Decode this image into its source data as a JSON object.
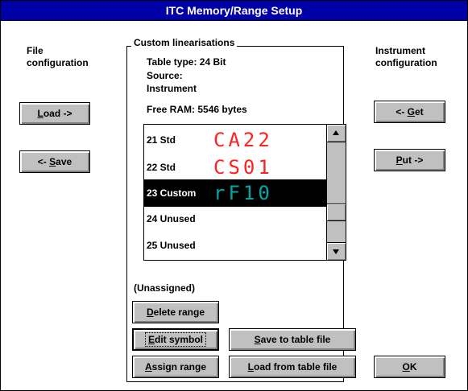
{
  "window": {
    "title": "ITC Memory/Range Setup"
  },
  "file_config": {
    "heading_line1": "File",
    "heading_line2": "configuration",
    "load_label": "Load ->",
    "save_label": "<- Save"
  },
  "instrument_config": {
    "heading_line1": "Instrument",
    "heading_line2": "configuration",
    "get_label": "<- Get",
    "put_label": "Put ->"
  },
  "custom": {
    "group_title": "Custom linearisations",
    "table_type": "Table type:  24 Bit",
    "source_label": "Source:",
    "source_value": "Instrument",
    "free_ram": "Free RAM: 5546 bytes",
    "items": [
      {
        "label": "21 Std",
        "symbol": "CA22",
        "symbol_color": "#ff2020"
      },
      {
        "label": "22 Std",
        "symbol": "CS01",
        "symbol_color": "#ff2020"
      },
      {
        "label": "23 Custom",
        "symbol": "rF10",
        "symbol_color": "#00a8a8"
      },
      {
        "label": "24 Unused",
        "symbol": ""
      },
      {
        "label": "25 Unused",
        "symbol": ""
      }
    ],
    "selected_index": 2,
    "assignment_status": "(Unassigned)",
    "delete_range": "Delete range",
    "edit_symbol": "Edit symbol",
    "assign_range": "Assign range",
    "save_to_table_file": "Save to table file",
    "load_from_table_file": "Load from table file"
  },
  "ok_label": "OK",
  "colors": {
    "titlebar": "#0000a8",
    "button_face": "#c0c0c0",
    "selection": "#000000"
  }
}
